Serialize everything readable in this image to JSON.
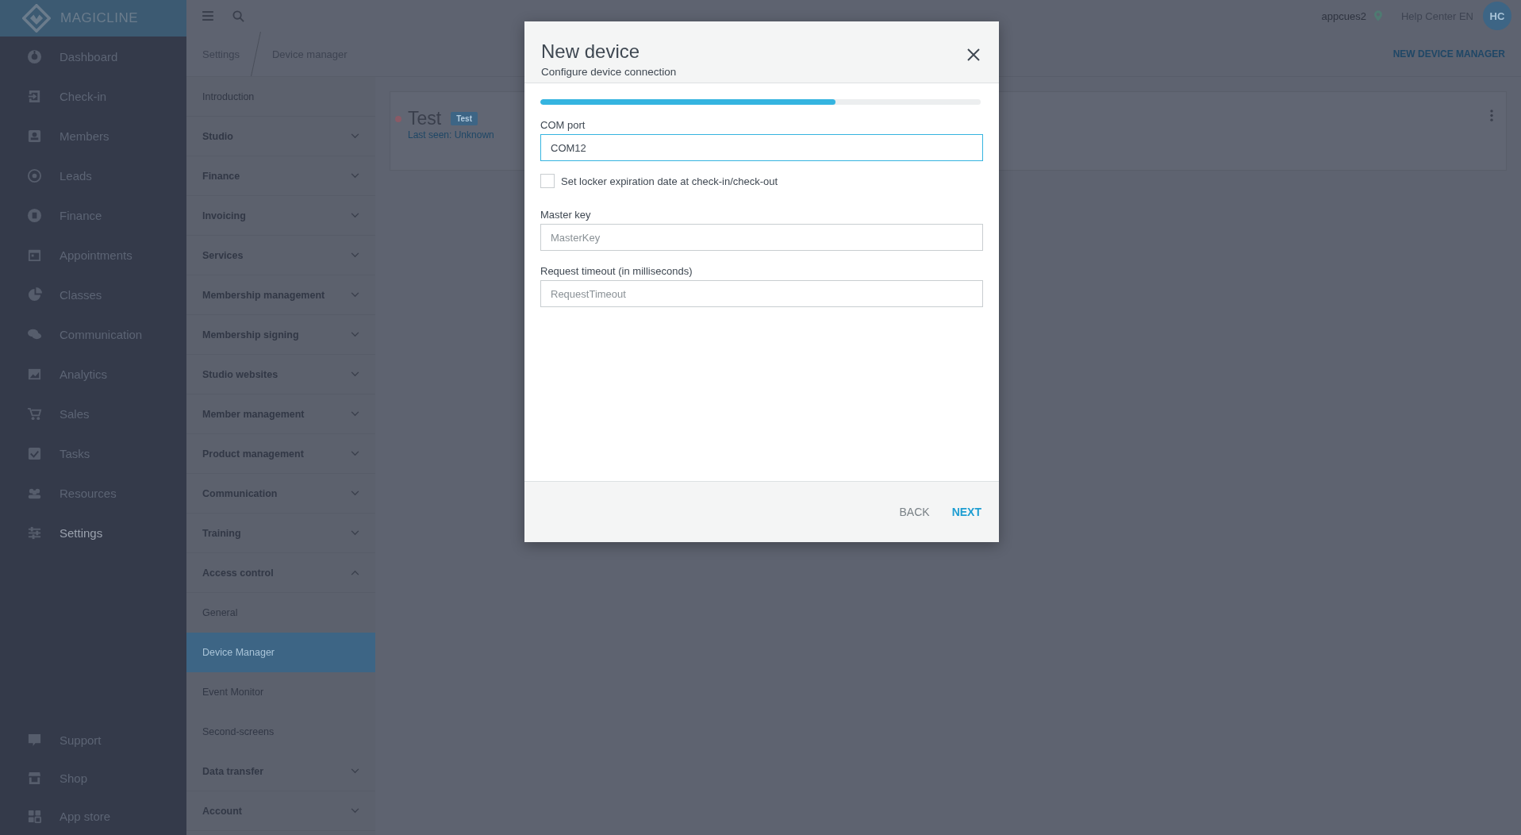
{
  "brand": {
    "name": "MAGICLINE"
  },
  "nav": {
    "items": [
      {
        "label": "Dashboard",
        "selected": false
      },
      {
        "label": "Check-in",
        "selected": false
      },
      {
        "label": "Members",
        "selected": false
      },
      {
        "label": "Leads",
        "selected": false
      },
      {
        "label": "Finance",
        "selected": false
      },
      {
        "label": "Appointments",
        "selected": false
      },
      {
        "label": "Classes",
        "selected": false
      },
      {
        "label": "Communication",
        "selected": false
      },
      {
        "label": "Analytics",
        "selected": false
      },
      {
        "label": "Sales",
        "selected": false
      },
      {
        "label": "Tasks",
        "selected": false
      },
      {
        "label": "Resources",
        "selected": false
      },
      {
        "label": "Settings",
        "selected": true
      }
    ],
    "bottom_items": [
      {
        "label": "Support",
        "selected": false
      },
      {
        "label": "Shop",
        "selected": false
      },
      {
        "label": "App store",
        "selected": false
      }
    ]
  },
  "topbar": {
    "user": "appcues2",
    "help": "Help Center EN",
    "avatar": "HC"
  },
  "breadcrumb": [
    "Settings",
    "Device manager"
  ],
  "settings_menu": [
    {
      "kind": "link",
      "label": "Introduction",
      "selected": false
    },
    {
      "kind": "group",
      "label": "Studio",
      "expanded": false
    },
    {
      "kind": "group",
      "label": "Finance",
      "expanded": false
    },
    {
      "kind": "group",
      "label": "Invoicing",
      "expanded": false
    },
    {
      "kind": "group",
      "label": "Services",
      "expanded": false
    },
    {
      "kind": "group",
      "label": "Membership management",
      "expanded": false
    },
    {
      "kind": "group",
      "label": "Membership signing",
      "expanded": false
    },
    {
      "kind": "group",
      "label": "Studio websites",
      "expanded": false
    },
    {
      "kind": "group",
      "label": "Member management",
      "expanded": false
    },
    {
      "kind": "group",
      "label": "Product management",
      "expanded": false
    },
    {
      "kind": "group",
      "label": "Communication",
      "expanded": false
    },
    {
      "kind": "group",
      "label": "Training",
      "expanded": false
    },
    {
      "kind": "group",
      "label": "Access control",
      "expanded": true,
      "children": [
        {
          "kind": "link",
          "label": "General",
          "selected": false
        },
        {
          "kind": "link",
          "label": "Device Manager",
          "selected": true
        },
        {
          "kind": "link",
          "label": "Event Monitor",
          "selected": false
        },
        {
          "kind": "link",
          "label": "Second-screens",
          "selected": false
        }
      ]
    },
    {
      "kind": "group",
      "label": "Data transfer",
      "expanded": false
    },
    {
      "kind": "group",
      "label": "Account",
      "expanded": false
    }
  ],
  "header_action": "NEW DEVICE MANAGER",
  "devices": [
    {
      "name": "Test",
      "badge": "Test",
      "last_seen": "Last seen: Unknown",
      "color": "#8a5a66"
    }
  ],
  "dialog": {
    "title": "New device",
    "subtitle": "Configure device connection",
    "progress": {
      "level": 0.67
    },
    "fields": [
      {
        "kind": "text",
        "label": "COM port",
        "value": "COM12",
        "focused": true
      },
      {
        "kind": "checkbox",
        "label": "Set locker expiration date at check-in/check-out",
        "checked": false
      },
      {
        "kind": "text",
        "label": "Master key",
        "placeholder": "MasterKey",
        "focused": false
      },
      {
        "kind": "text",
        "label": "Request timeout (in milliseconds)",
        "placeholder": "RequestTimeout",
        "focused": false
      }
    ],
    "buttons": [
      {
        "label": "BACK",
        "kind": "secondary"
      },
      {
        "label": "NEXT",
        "kind": "primary"
      }
    ]
  }
}
